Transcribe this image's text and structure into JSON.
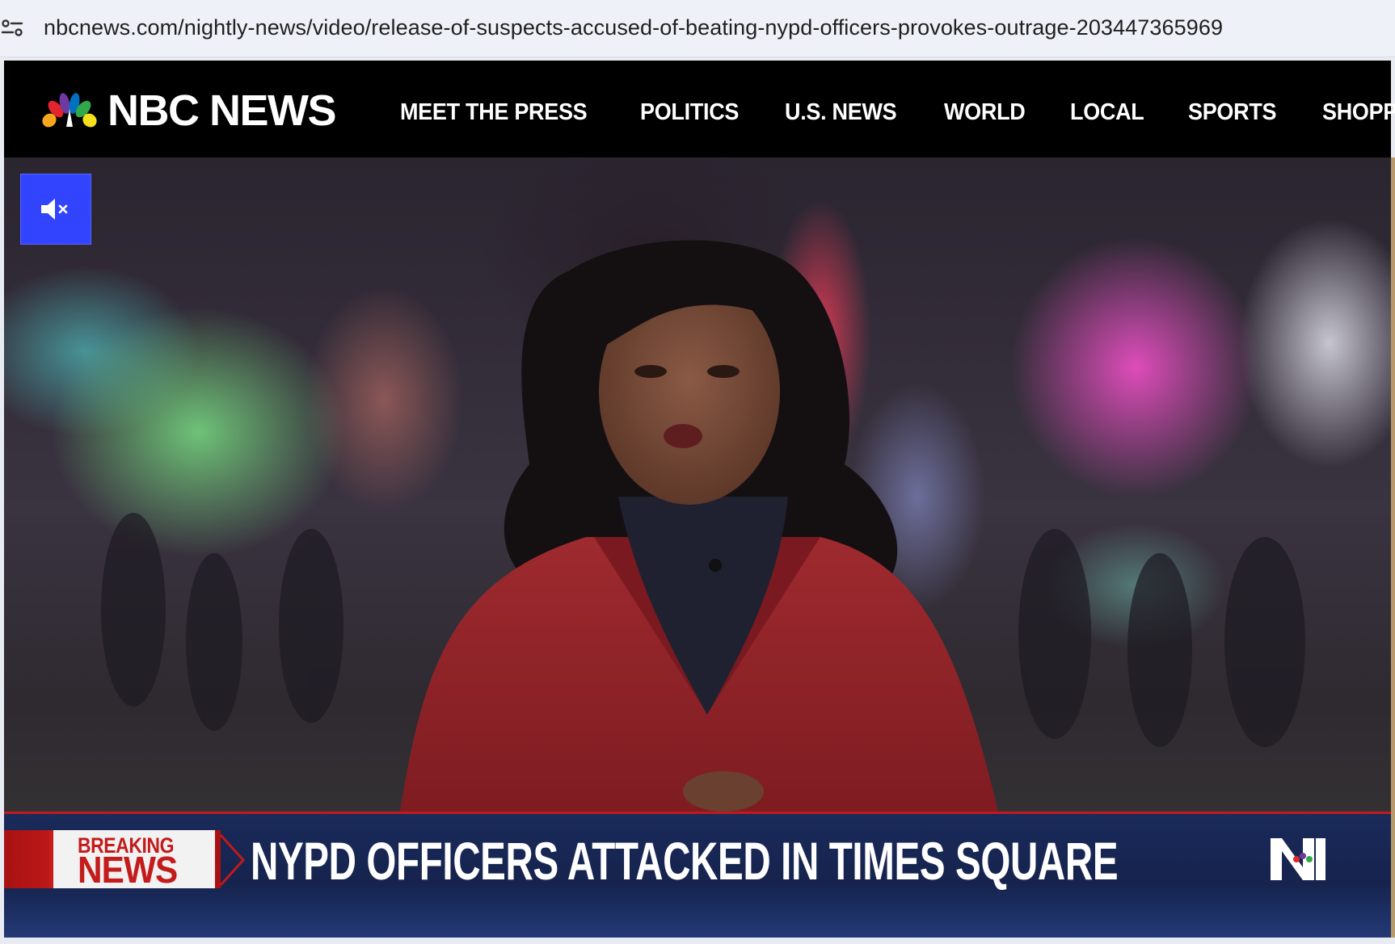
{
  "browser": {
    "url": "nbcnews.com/nightly-news/video/release-of-suspects-accused-of-beating-nypd-officers-provokes-outrage-203447365969"
  },
  "header": {
    "brand": "NBC NEWS",
    "nav": [
      "MEET THE PRESS",
      "POLITICS",
      "U.S. NEWS",
      "WORLD",
      "LOCAL",
      "SPORTS",
      "SHOPPING"
    ]
  },
  "video": {
    "mute_icon": "speaker-muted-icon",
    "lower_third": {
      "breaking_top": "BREAKING",
      "breaking_bottom": "NEWS",
      "headline": "NYPD OFFICERS ATTACKED IN TIMES SQUARE"
    }
  },
  "colors": {
    "header_bg": "#000000",
    "mute_button": "#3344ff",
    "lower_third_bg": "#15234d",
    "breaking_red": "#c41b1b"
  }
}
